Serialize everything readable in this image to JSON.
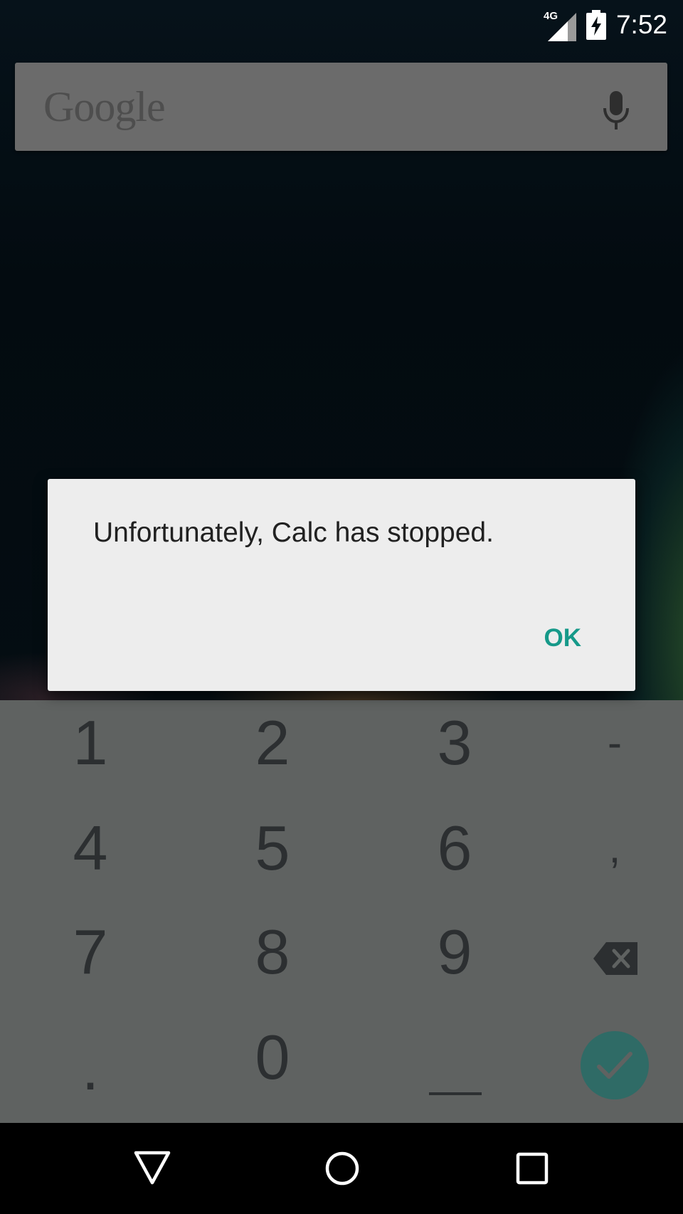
{
  "status_bar": {
    "network": "4G",
    "time": "7:52"
  },
  "search": {
    "logo_text": "Google",
    "mic_icon": "microphone-icon"
  },
  "keypad": {
    "row1": [
      "1",
      "2",
      "3",
      "-"
    ],
    "row2": [
      "4",
      "5",
      "6",
      ","
    ],
    "row3": [
      "7",
      "8",
      "9"
    ],
    "row4": [
      ".",
      "0"
    ],
    "icons": {
      "backspace": "backspace-icon",
      "done": "check-icon",
      "space": "underscore-icon"
    },
    "accent_color": "#2f6b66"
  },
  "dialog": {
    "message": "Unfortunately, Calc has stopped.",
    "ok_label": "OK",
    "accent_color": "#169989"
  },
  "nav": {
    "back": "back-triangle-icon",
    "home": "home-circle-icon",
    "recents": "recents-square-icon"
  }
}
